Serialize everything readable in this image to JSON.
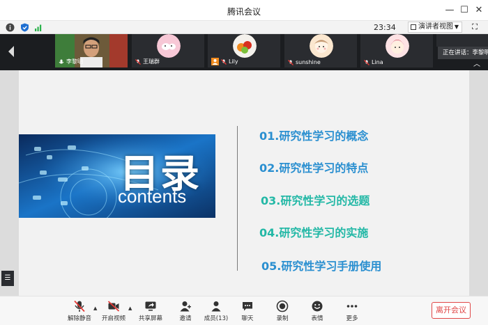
{
  "window": {
    "title": "腾讯会议"
  },
  "status": {
    "timer": "23:34",
    "view_label": "演讲者视图"
  },
  "participants": [
    {
      "name": "李黎明"
    },
    {
      "name": "王瑞群"
    },
    {
      "name": "Lily"
    },
    {
      "name": "sunshine"
    },
    {
      "name": "Lina"
    }
  ],
  "speaking": {
    "text": "正在讲话：李黎明"
  },
  "slide": {
    "banner_title": "目录",
    "banner_subtitle": "contents",
    "items": [
      {
        "text": "01.研究性学习的概念",
        "color": "#2a8fd0"
      },
      {
        "text": "02.研究性学习的特点",
        "color": "#2a8fd0"
      },
      {
        "text": "03.研究性学习的选题",
        "color": "#23b8a6"
      },
      {
        "text": "04.研究性学习的实施",
        "color": "#23b8a6"
      },
      {
        "text": "05.研究性学习手册使用",
        "color": "#2a8fd0"
      }
    ]
  },
  "toolbar": {
    "mute": "解除静音",
    "video": "开启视频",
    "share": "共享屏幕",
    "invite": "邀请",
    "members": "成员(13)",
    "chat": "聊天",
    "record": "录制",
    "emoji": "表情",
    "more": "更多",
    "leave": "离开会议"
  }
}
